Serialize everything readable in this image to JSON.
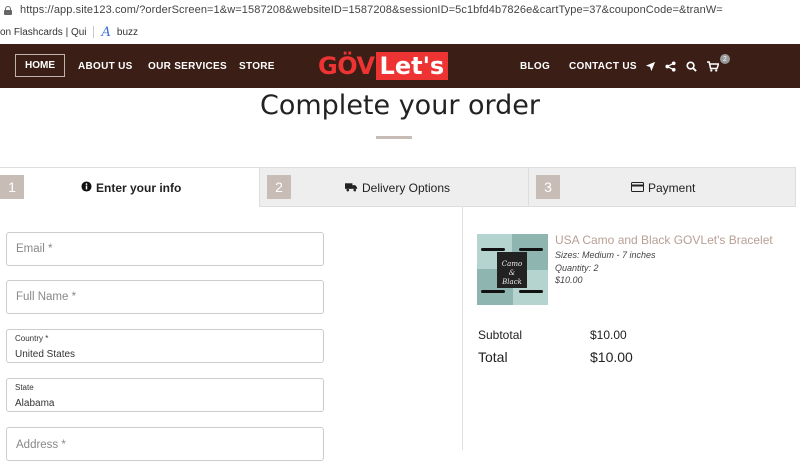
{
  "browser": {
    "url": "https://app.site123.com/?orderScreen=1&w=1587208&websiteID=1587208&sessionID=5c1bfd4b7826e&cartType=37&couponCode=&tranW=",
    "bookmarks": [
      {
        "label": "on Flashcards | Qui"
      },
      {
        "label": "buzz"
      }
    ]
  },
  "nav": {
    "items": [
      "HOME",
      "ABOUT US",
      "OUR SERVICES",
      "STORE",
      "BLOG",
      "CONTACT US"
    ],
    "logo_left": "GÖV",
    "logo_right": "Let's",
    "cart_count": "2"
  },
  "page": {
    "title": "Complete your order"
  },
  "steps": [
    {
      "num": "1",
      "label": "Enter your info",
      "icon": "info-icon"
    },
    {
      "num": "2",
      "label": "Delivery Options",
      "icon": "truck-icon"
    },
    {
      "num": "3",
      "label": "Payment",
      "icon": "credit-card-icon"
    }
  ],
  "form": {
    "email_placeholder": "Email *",
    "fullname_placeholder": "Full Name *",
    "country_label": "Country *",
    "country_value": "United States",
    "state_label": "State",
    "state_value": "Alabama",
    "address_placeholder": "Address *"
  },
  "order": {
    "product_title": "USA Camo and Black GOVLet's Bracelet",
    "sizes": "Sizes: Medium - 7 inches",
    "quantity": "Quantity: 2",
    "price": "$10.00",
    "thumb_text_1": "Camo",
    "thumb_text_2": "&",
    "thumb_text_3": "Black",
    "subtotal_label": "Subtotal",
    "subtotal_value": "$10.00",
    "total_label": "Total",
    "total_value": "$10.00"
  },
  "colors": {
    "nav_bg": "#3b1f17",
    "accent": "#c8bdb6",
    "logo_red": "#e33333",
    "product_link": "#b89f94"
  }
}
